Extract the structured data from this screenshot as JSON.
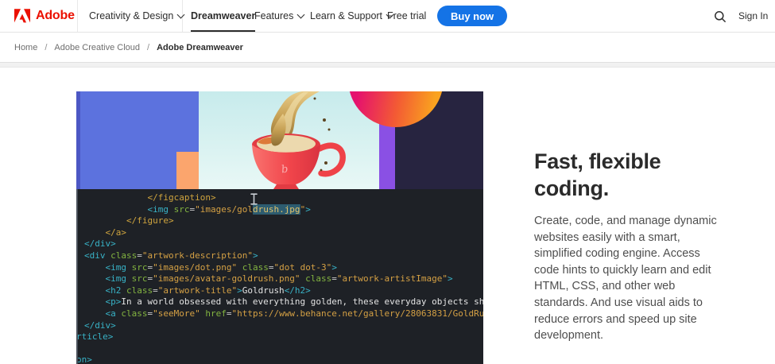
{
  "header": {
    "brand": "Adobe",
    "logo_icon": "adobe-a-mark",
    "nav": [
      {
        "label": "Creativity & Design",
        "dropdown": true,
        "active": false
      },
      {
        "label": "Dreamweaver",
        "dropdown": false,
        "active": true
      },
      {
        "label": "Features",
        "dropdown": true,
        "active": false
      },
      {
        "label": "Learn & Support",
        "dropdown": true,
        "active": false
      },
      {
        "label": "Free trial",
        "dropdown": false,
        "active": false
      }
    ],
    "buy_button": "Buy now",
    "search_icon": "magnifying-glass",
    "sign_in": "Sign In"
  },
  "breadcrumb": {
    "separator": "/",
    "items": [
      "Home",
      "Adobe Creative Cloud",
      "Adobe Dreamweaver"
    ]
  },
  "content": {
    "heading": "Fast, flexible coding.",
    "body": "Create, code, and manage dynamic websites easily with a smart, simplified coding engine. Access code hints to quickly learn and edit HTML, CSS, and other web standards. And use visual aids to reduce errors and speed up site development."
  },
  "code_editor": {
    "cursor_icon": "text-ibeam-cursor",
    "selection_text": "drush.jpg",
    "lines": [
      {
        "indent": 12,
        "tokens": [
          [
            "gtag",
            "</figcaption>"
          ]
        ]
      },
      {
        "indent": 12,
        "tokens": [
          [
            "tag",
            "<img"
          ],
          [
            "plain",
            " "
          ],
          [
            "attr",
            "src"
          ],
          [
            "eq",
            "="
          ],
          [
            "val",
            "\"images/gol"
          ],
          [
            "sel",
            "drush.jpg"
          ],
          [
            "val",
            "\""
          ],
          [
            "tag",
            ">"
          ]
        ]
      },
      {
        "indent": 8,
        "tokens": [
          [
            "gtag",
            "</figure>"
          ]
        ]
      },
      {
        "indent": 4,
        "tokens": [
          [
            "gtag",
            "</a>"
          ]
        ]
      },
      {
        "indent": 0,
        "tokens": [
          [
            "tag",
            "</div>"
          ]
        ]
      },
      {
        "indent": 0,
        "tokens": [
          [
            "tag",
            "<div"
          ],
          [
            "plain",
            " "
          ],
          [
            "attr",
            "class"
          ],
          [
            "eq",
            "="
          ],
          [
            "val",
            "\"artwork-description\""
          ],
          [
            "tag",
            ">"
          ]
        ]
      },
      {
        "indent": 4,
        "tokens": [
          [
            "tag",
            "<img"
          ],
          [
            "plain",
            " "
          ],
          [
            "attr",
            "src"
          ],
          [
            "eq",
            "="
          ],
          [
            "val",
            "\"images/dot.png\""
          ],
          [
            "plain",
            " "
          ],
          [
            "attr",
            "class"
          ],
          [
            "eq",
            "="
          ],
          [
            "val",
            "\"dot dot-3\""
          ],
          [
            "tag",
            ">"
          ]
        ]
      },
      {
        "indent": 4,
        "tokens": [
          [
            "tag",
            "<img"
          ],
          [
            "plain",
            " "
          ],
          [
            "attr",
            "src"
          ],
          [
            "eq",
            "="
          ],
          [
            "val",
            "\"images/avatar-goldrush.png\""
          ],
          [
            "plain",
            " "
          ],
          [
            "attr",
            "class"
          ],
          [
            "eq",
            "="
          ],
          [
            "val",
            "\"artwork-artistImage\""
          ],
          [
            "tag",
            ">"
          ]
        ]
      },
      {
        "indent": 4,
        "tokens": [
          [
            "tag",
            "<h2"
          ],
          [
            "plain",
            " "
          ],
          [
            "attr",
            "class"
          ],
          [
            "eq",
            "="
          ],
          [
            "val",
            "\"artwork-title\""
          ],
          [
            "tag",
            ">"
          ],
          [
            "plain",
            "Goldrush"
          ],
          [
            "tag",
            "</h2>"
          ]
        ]
      },
      {
        "indent": 4,
        "tokens": [
          [
            "tag",
            "<p>"
          ],
          [
            "plain",
            "In a world obsessed with everything golden, these everyday objects sh"
          ]
        ]
      },
      {
        "indent": 4,
        "tokens": [
          [
            "tag",
            "<a"
          ],
          [
            "plain",
            " "
          ],
          [
            "attr",
            "class"
          ],
          [
            "eq",
            "="
          ],
          [
            "val",
            "\"seeMore\""
          ],
          [
            "plain",
            " "
          ],
          [
            "attr",
            "href"
          ],
          [
            "eq",
            "="
          ],
          [
            "val",
            "\"https://www.behance.net/gallery/28063831/GoldRu"
          ]
        ]
      },
      {
        "indent": 0,
        "tokens": [
          [
            "tag",
            "</div>"
          ]
        ]
      },
      {
        "indent": 0,
        "clipped": true,
        "tokens": [
          [
            "tag",
            "rticle>"
          ]
        ]
      },
      {
        "indent": 0,
        "tokens": []
      },
      {
        "indent": 0,
        "clipped": true,
        "tokens": [
          [
            "tag",
            "on>"
          ]
        ]
      }
    ]
  },
  "colors": {
    "adobe_red": "#eb1000",
    "buy_blue": "#1473e6",
    "code_bg": "#1e2126",
    "tag_teal": "#38b2c6",
    "tag_gold": "#cfa43e",
    "attr_green": "#83b440",
    "value_gold": "#d4a044",
    "selection_bg": "#2d5c70",
    "banner_blue": "#5c72de",
    "banner_cyan": "#d9f2f1",
    "banner_purple": "#8a50e4",
    "banner_navy": "#272440",
    "banner_orange": "#fba56d",
    "circle_magenta": "#e5116e",
    "circle_orange": "#f9a21f",
    "cup_red": "#f1454b"
  }
}
